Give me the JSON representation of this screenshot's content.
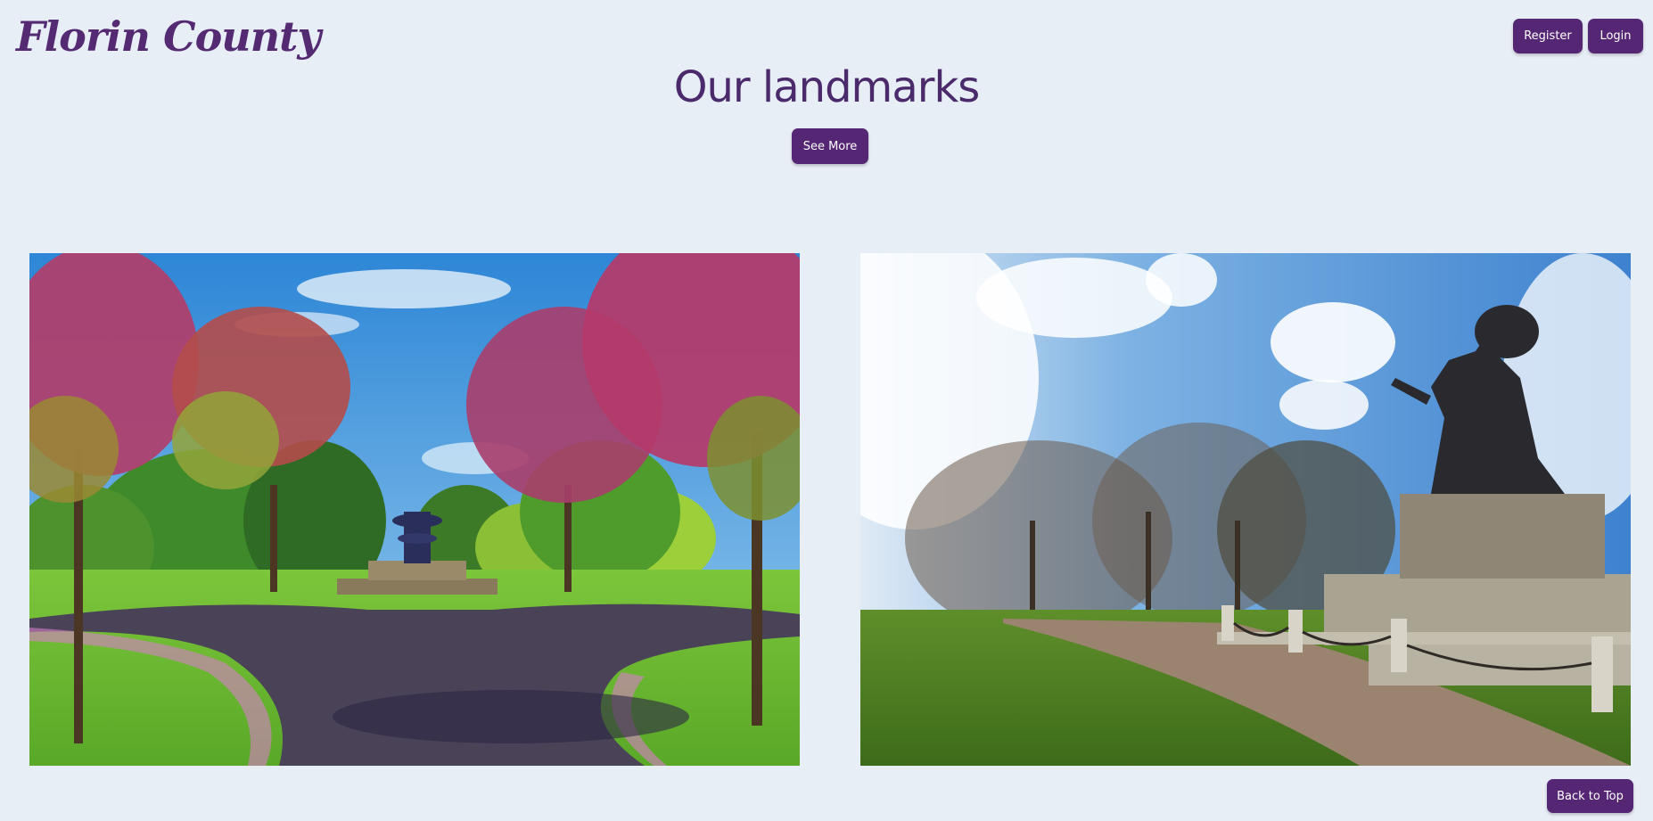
{
  "header": {
    "logo_text": "Florin County",
    "register_label": "Register",
    "login_label": "Login"
  },
  "main": {
    "title": "Our landmarks",
    "see_more_label": "See More",
    "images": [
      {
        "subject": "park-fountain-blossom-trees"
      },
      {
        "subject": "bronze-statue-monument"
      }
    ]
  },
  "footer": {
    "back_to_top_label": "Back to Top"
  },
  "colors": {
    "background": "#e8eef6",
    "brand_purple": "#552673",
    "heading_purple": "#4b2a6c"
  }
}
